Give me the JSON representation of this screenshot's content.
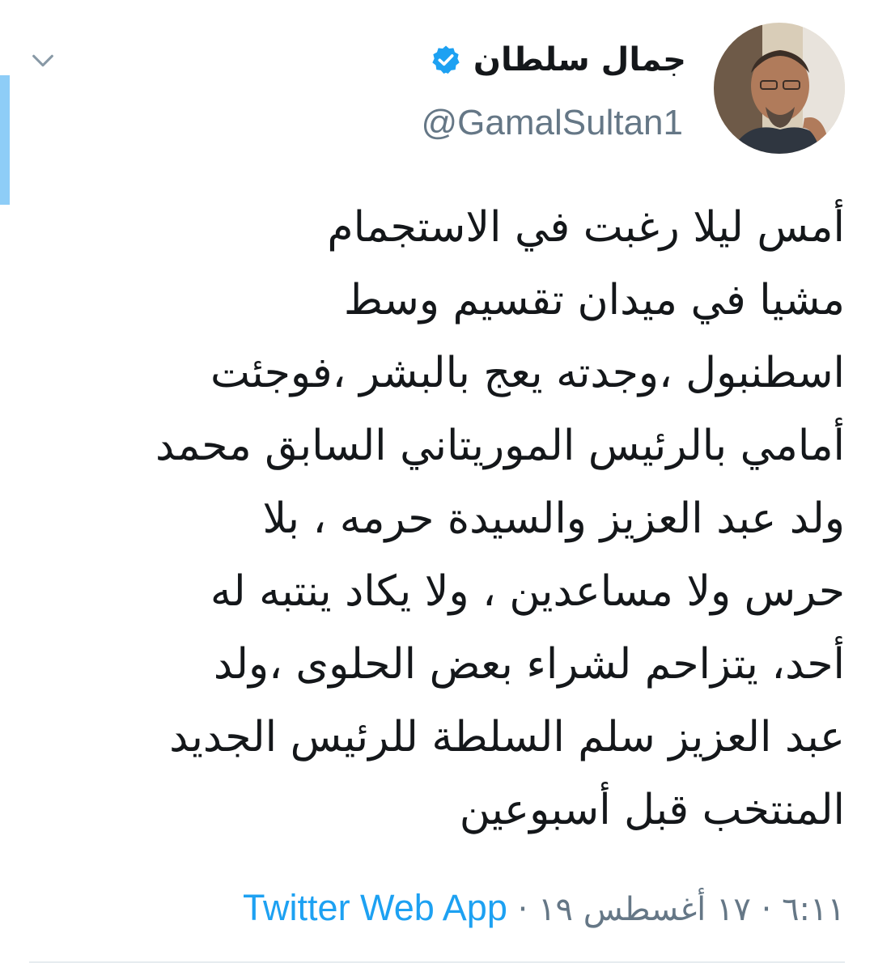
{
  "tweet": {
    "author": {
      "display_name": "جمال سلطان",
      "handle": "@GamalSultan1",
      "verified": true,
      "verified_icon": "verified-badge-icon"
    },
    "text_lines": [
      "أمس ليلا رغبت في الاستجمام",
      "مشيا في ميدان تقسيم وسط",
      "اسطنبول ،وجدته يعج بالبشر ،فوجئت",
      "أمامي بالرئيس الموريتاني السابق محمد",
      "ولد عبد العزيز والسيدة حرمه ، بلا",
      "حرس ولا مساعدين ، ولا يكاد ينتبه له",
      "أحد، يتزاحم لشراء بعض الحلوى ،ولد",
      "عبد العزيز سلم السلطة للرئيس الجديد",
      "المنتخب قبل أسبوعين"
    ],
    "time": "٦:١١",
    "separator": "·",
    "date": "١٧ أغسطس ١٩",
    "source": "Twitter Web App"
  },
  "icons": {
    "chevron": "chevron-down-icon",
    "avatar": "avatar"
  },
  "colors": {
    "accent": "#1da1f2",
    "secondary_text": "#657786",
    "primary_text": "#14171a",
    "left_accent_bar": "#8ecdf7"
  }
}
